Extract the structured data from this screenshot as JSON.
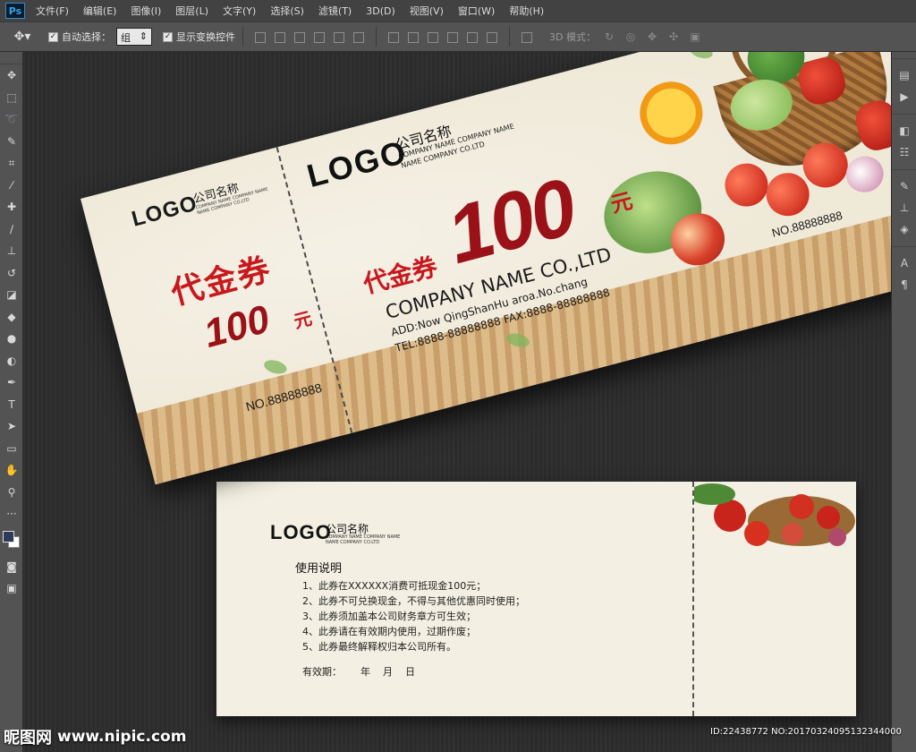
{
  "app": {
    "logo": "Ps"
  },
  "menu": [
    "文件(F)",
    "编辑(E)",
    "图像(I)",
    "图层(L)",
    "文字(Y)",
    "选择(S)",
    "滤镜(T)",
    "3D(D)",
    "视图(V)",
    "窗口(W)",
    "帮助(H)"
  ],
  "options": {
    "auto_select_label": "自动选择：",
    "auto_select_value": "组",
    "show_transform_label": "显示变换控件",
    "mode3d_label": "3D 模式："
  },
  "tools": [
    "move-tool",
    "marquee-tool",
    "lasso-tool",
    "quick-select-tool",
    "crop-tool",
    "eyedropper-tool",
    "healing-brush-tool",
    "brush-tool",
    "clone-stamp-tool",
    "history-brush-tool",
    "eraser-tool",
    "paint-bucket-tool",
    "blur-tool",
    "dodge-tool",
    "pen-tool",
    "type-tool",
    "path-select-tool",
    "shape-tool",
    "hand-tool",
    "zoom-tool"
  ],
  "colors": {
    "accent_red": "#c8181d",
    "dark_red": "#9a1218",
    "paper": "#efe9d8"
  },
  "voucher_front": {
    "stub": {
      "logo": "LOGO",
      "company": "公司名称",
      "sub1": "COMPANY NAME COMPANY NAME",
      "sub2": "NAME COMPANY CO.LTD",
      "title": "代金券",
      "amount": "100",
      "unit": "元",
      "number": "NO.88888888"
    },
    "main": {
      "logo": "LOGO",
      "company": "公司名称",
      "sub1": "COMPANY NAME COMPANY NAME",
      "sub2": "NAME COMPANY CO.LTD",
      "title": "代金券",
      "amount": "100",
      "unit": "元",
      "company_name": "COMPANY NAME CO.,LTD",
      "address": "ADD:Now QingShanHu aroa.No.chang",
      "tel": "TEL:8888-88888888   FAX:8888-88888888",
      "number": "NO.88888888"
    }
  },
  "voucher_back": {
    "logo": "LOGO",
    "company": "公司名称",
    "sub1": "COMPANY NAME COMPANY NAME",
    "sub2": "NAME COMPANY CO.LTD",
    "heading": "使用说明",
    "rules": [
      "1、此券在XXXXXX消费可抵现金100元；",
      "2、此券不可兑换现金，不得与其他优惠同时使用；",
      "3、此券须加盖本公司财务章方可生效；",
      "4、此券请在有效期内使用，过期作废；",
      "5、此券最终解释权归本公司所有。"
    ],
    "validity": "有效期：      年    月    日"
  },
  "watermark": {
    "site": "昵图网",
    "url": "www.nipic.com",
    "id": "ID:22438772 NO:20170324095132344000"
  }
}
